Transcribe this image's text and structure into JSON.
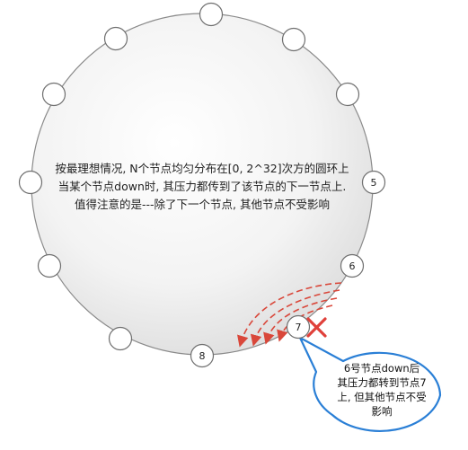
{
  "description_lines": [
    "按最理想情况, N个节点均匀分布在[0, 2^32]次方的圆环上",
    "当某个节点down时, 其压力都传到了该节点的下一节点上.",
    "值得注意的是---除了下一个节点, 其他节点不受影响"
  ],
  "nodes": [
    {
      "label": ""
    },
    {
      "label": ""
    },
    {
      "label": ""
    },
    {
      "label": "5"
    },
    {
      "label": "6"
    },
    {
      "label": "7"
    },
    {
      "label": "8"
    },
    {
      "label": ""
    },
    {
      "label": ""
    },
    {
      "label": ""
    },
    {
      "label": ""
    },
    {
      "label": ""
    }
  ],
  "down_node_label": "6",
  "callout_lines": [
    "6号节点down后",
    "其压力都转到节点7",
    "上, 但其他节点不受",
    "影响"
  ],
  "colors": {
    "ring_fill_light": "#ffffff",
    "ring_fill_dark": "#d8d8d8",
    "ring_stroke": "#8a8a8a",
    "arrow": "#d9473a",
    "cross": "#e0403a",
    "callout_stroke": "#2a7fd6"
  }
}
